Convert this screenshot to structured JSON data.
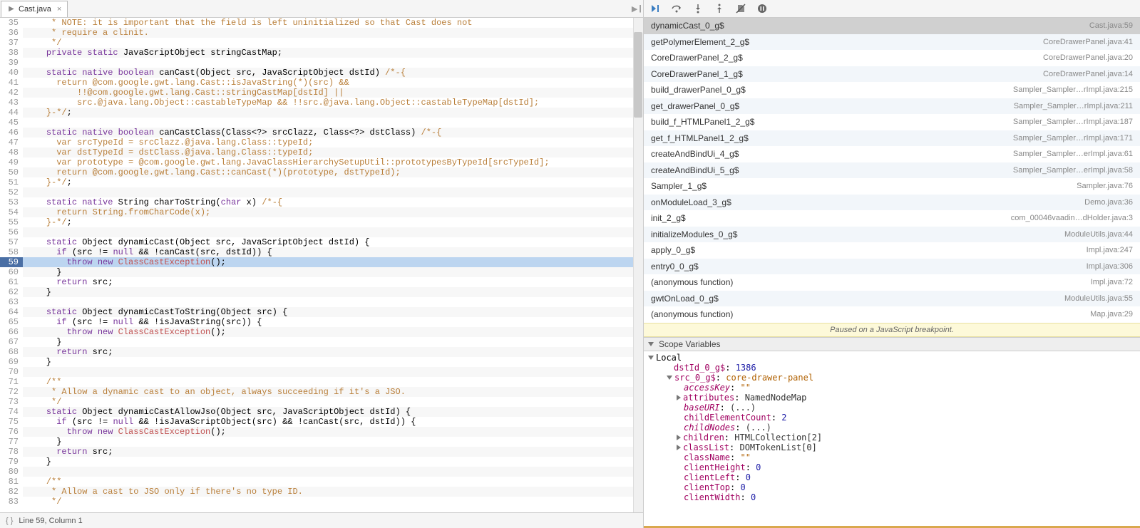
{
  "editor": {
    "tab_name": "Cast.java",
    "status_text": "Line 59, Column 1",
    "highlighted_line": 59,
    "lines": [
      {
        "n": 35,
        "h": "     * NOTE: it is important that the field is left uninitialized so that Cast does not",
        "cls": "com"
      },
      {
        "n": 36,
        "h": "     * require a clinit.",
        "cls": "com"
      },
      {
        "n": 37,
        "h": "     */",
        "cls": "com"
      },
      {
        "n": 38,
        "h": "    <kw>private static</kw> JavaScriptObject stringCastMap;"
      },
      {
        "n": 39,
        "h": ""
      },
      {
        "n": 40,
        "h": "    <kw>static native boolean</kw> canCast(Object src, JavaScriptObject dstId) <com>/*-{</com>"
      },
      {
        "n": 41,
        "h": "      <com>return @com.google.gwt.lang.Cast::isJavaString(*)(src) &&</com>"
      },
      {
        "n": 42,
        "h": "          <com>!!@com.google.gwt.lang.Cast::stringCastMap[dstId] ||</com>"
      },
      {
        "n": 43,
        "h": "          <com>src.@java.lang.Object::castableTypeMap && !!src.@java.lang.Object::castableTypeMap[dstId];</com>"
      },
      {
        "n": 44,
        "h": "    <com>}-*/</com>;"
      },
      {
        "n": 45,
        "h": ""
      },
      {
        "n": 46,
        "h": "    <kw>static native boolean</kw> canCastClass(Class&lt;?&gt; srcClazz, Class&lt;?&gt; dstClass) <com>/*-{</com>"
      },
      {
        "n": 47,
        "h": "      <com>var srcTypeId = srcClazz.@java.lang.Class::typeId;</com>"
      },
      {
        "n": 48,
        "h": "      <com>var dstTypeId = dstClass.@java.lang.Class::typeId;</com>"
      },
      {
        "n": 49,
        "h": "      <com>var prototype = @com.google.gwt.lang.JavaClassHierarchySetupUtil::prototypesByTypeId[srcTypeId];</com>"
      },
      {
        "n": 50,
        "h": "      <com>return @com.google.gwt.lang.Cast::canCast(*)(prototype, dstTypeId);</com>"
      },
      {
        "n": 51,
        "h": "    <com>}-*/</com>;"
      },
      {
        "n": 52,
        "h": ""
      },
      {
        "n": 53,
        "h": "    <kw>static native</kw> String charToString(<kw>char</kw> x) <com>/*-{</com>"
      },
      {
        "n": 54,
        "h": "      <com>return String.fromCharCode(x);</com>"
      },
      {
        "n": 55,
        "h": "    <com>}-*/</com>;"
      },
      {
        "n": 56,
        "h": ""
      },
      {
        "n": 57,
        "h": "    <kw>static</kw> Object dynamicCast(Object src, JavaScriptObject dstId) {"
      },
      {
        "n": 58,
        "h": "      <kw>if</kw> (src != <kw>null</kw> && !canCast(src, dstId)) {"
      },
      {
        "n": 59,
        "h": "        <kw>throw new</kw> <cls>ClassCastException</cls>();"
      },
      {
        "n": 60,
        "h": "      }"
      },
      {
        "n": 61,
        "h": "      <kw>return</kw> src;"
      },
      {
        "n": 62,
        "h": "    }"
      },
      {
        "n": 63,
        "h": ""
      },
      {
        "n": 64,
        "h": "    <kw>static</kw> Object dynamicCastToString(Object src) {"
      },
      {
        "n": 65,
        "h": "      <kw>if</kw> (src != <kw>null</kw> && !isJavaString(src)) {"
      },
      {
        "n": 66,
        "h": "        <kw>throw new</kw> <cls>ClassCastException</cls>();"
      },
      {
        "n": 67,
        "h": "      }"
      },
      {
        "n": 68,
        "h": "      <kw>return</kw> src;"
      },
      {
        "n": 69,
        "h": "    }"
      },
      {
        "n": 70,
        "h": ""
      },
      {
        "n": 71,
        "h": "    <com>/**</com>"
      },
      {
        "n": 72,
        "h": "     <com>* Allow a dynamic cast to an object, always succeeding if it's a JSO.</com>"
      },
      {
        "n": 73,
        "h": "     <com>*/</com>"
      },
      {
        "n": 74,
        "h": "    <kw>static</kw> Object dynamicCastAllowJso(Object src, JavaScriptObject dstId) {"
      },
      {
        "n": 75,
        "h": "      <kw>if</kw> (src != <kw>null</kw> && !isJavaScriptObject(src) && !canCast(src, dstId)) {"
      },
      {
        "n": 76,
        "h": "        <kw>throw new</kw> <cls>ClassCastException</cls>();"
      },
      {
        "n": 77,
        "h": "      }"
      },
      {
        "n": 78,
        "h": "      <kw>return</kw> src;"
      },
      {
        "n": 79,
        "h": "    }"
      },
      {
        "n": 80,
        "h": ""
      },
      {
        "n": 81,
        "h": "    <com>/**</com>"
      },
      {
        "n": 82,
        "h": "     <com>* Allow a cast to JSO only if there's no type ID.</com>"
      },
      {
        "n": 83,
        "h": "     <com>*/</com>"
      }
    ]
  },
  "debug": {
    "pause_message": "Paused on a JavaScript breakpoint.",
    "scope_header": "Scope Variables",
    "local_label": "Local",
    "stack": [
      {
        "fn": "dynamicCast_0_g$",
        "loc": "Cast.java:59",
        "sel": true
      },
      {
        "fn": "getPolymerElement_2_g$",
        "loc": "CoreDrawerPanel.java:41"
      },
      {
        "fn": "CoreDrawerPanel_2_g$",
        "loc": "CoreDrawerPanel.java:20"
      },
      {
        "fn": "CoreDrawerPanel_1_g$",
        "loc": "CoreDrawerPanel.java:14"
      },
      {
        "fn": "build_drawerPanel_0_g$",
        "loc": "Sampler_Sampler…rImpl.java:215"
      },
      {
        "fn": "get_drawerPanel_0_g$",
        "loc": "Sampler_Sampler…rImpl.java:211"
      },
      {
        "fn": "build_f_HTMLPanel1_2_g$",
        "loc": "Sampler_Sampler…rImpl.java:187"
      },
      {
        "fn": "get_f_HTMLPanel1_2_g$",
        "loc": "Sampler_Sampler…rImpl.java:171"
      },
      {
        "fn": "createAndBindUi_4_g$",
        "loc": "Sampler_Sampler…erImpl.java:61"
      },
      {
        "fn": "createAndBindUi_5_g$",
        "loc": "Sampler_Sampler…erImpl.java:58"
      },
      {
        "fn": "Sampler_1_g$",
        "loc": "Sampler.java:76"
      },
      {
        "fn": "onModuleLoad_3_g$",
        "loc": "Demo.java:36"
      },
      {
        "fn": "init_2_g$",
        "loc": "com_00046vaadin…dHolder.java:3"
      },
      {
        "fn": "initializeModules_0_g$",
        "loc": "ModuleUtils.java:44"
      },
      {
        "fn": "apply_0_g$",
        "loc": "Impl.java:247"
      },
      {
        "fn": "entry0_0_g$",
        "loc": "Impl.java:306"
      },
      {
        "fn": "(anonymous function)",
        "loc": "Impl.java:72"
      },
      {
        "fn": "gwtOnLoad_0_g$",
        "loc": "ModuleUtils.java:55"
      },
      {
        "fn": "(anonymous function)",
        "loc": "Map.java:29"
      }
    ],
    "locals": [
      {
        "ind": 1,
        "tw": "",
        "key": "dstId_0_g$",
        "kcls": "t-key",
        "val": "1386",
        "vcls": "t-val-num"
      },
      {
        "ind": 1,
        "tw": "▾",
        "key": "src_0_g$",
        "kcls": "t-key",
        "val": "core-drawer-panel",
        "vcls": "t-val-str"
      },
      {
        "ind": 2,
        "tw": "",
        "key": "accessKey",
        "kcls": "t-key-em",
        "val": "\"\"",
        "vcls": "t-val-str"
      },
      {
        "ind": 2,
        "tw": "▸",
        "key": "attributes",
        "kcls": "t-key",
        "val": "NamedNodeMap",
        "vcls": "t-val-obj"
      },
      {
        "ind": 2,
        "tw": "",
        "key": "baseURI",
        "kcls": "t-key-em",
        "val": "(...)",
        "vcls": "t-val-obj"
      },
      {
        "ind": 2,
        "tw": "",
        "key": "childElementCount",
        "kcls": "t-key",
        "val": "2",
        "vcls": "t-val-num"
      },
      {
        "ind": 2,
        "tw": "",
        "key": "childNodes",
        "kcls": "t-key-em",
        "val": "(...)",
        "vcls": "t-val-obj"
      },
      {
        "ind": 2,
        "tw": "▸",
        "key": "children",
        "kcls": "t-key",
        "val": "HTMLCollection[2]",
        "vcls": "t-val-obj"
      },
      {
        "ind": 2,
        "tw": "▸",
        "key": "classList",
        "kcls": "t-key",
        "val": "DOMTokenList[0]",
        "vcls": "t-val-obj"
      },
      {
        "ind": 2,
        "tw": "",
        "key": "className",
        "kcls": "t-key",
        "val": "\"\"",
        "vcls": "t-val-str"
      },
      {
        "ind": 2,
        "tw": "",
        "key": "clientHeight",
        "kcls": "t-key",
        "val": "0",
        "vcls": "t-val-num"
      },
      {
        "ind": 2,
        "tw": "",
        "key": "clientLeft",
        "kcls": "t-key",
        "val": "0",
        "vcls": "t-val-num"
      },
      {
        "ind": 2,
        "tw": "",
        "key": "clientTop",
        "kcls": "t-key",
        "val": "0",
        "vcls": "t-val-num"
      },
      {
        "ind": 2,
        "tw": "",
        "key": "clientWidth",
        "kcls": "t-key",
        "val": "0",
        "vcls": "t-val-num"
      }
    ]
  }
}
